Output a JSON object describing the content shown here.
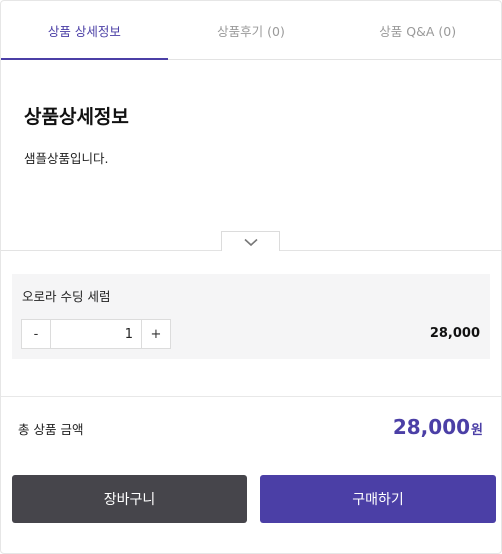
{
  "tabs": [
    {
      "label": "상품 상세정보",
      "active": true
    },
    {
      "label": "상품후기 (0)",
      "active": false
    },
    {
      "label": "상품 Q&A (0)",
      "active": false
    }
  ],
  "detail": {
    "title": "상품상세정보",
    "text": "샘플상품입니다."
  },
  "expand": {
    "icon": "chevron-down-icon"
  },
  "option": {
    "name": "오로라 수딩 세럼",
    "minus_label": "-",
    "plus_label": "+",
    "quantity": "1",
    "price": "28,000"
  },
  "total": {
    "label": "총 상품 금액",
    "amount": "28,000",
    "unit": "원"
  },
  "buttons": {
    "cart_label": "장바구니",
    "buy_label": "구매하기"
  },
  "colors": {
    "accent": "#4b3fa6",
    "cart_button": "#46454b",
    "option_bg": "#f5f5f6"
  }
}
